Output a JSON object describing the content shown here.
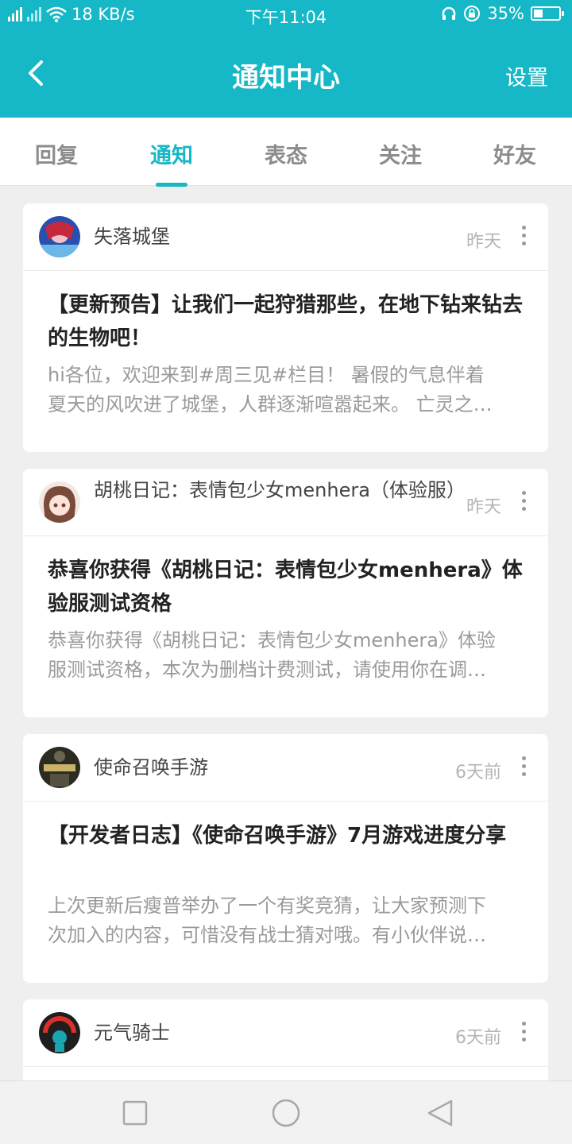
{
  "status_bar": {
    "network": "2G",
    "speed": "18 KB/s",
    "time": "下午11:04",
    "battery": "35%",
    "battery_level": 0.35
  },
  "header": {
    "title": "通知中心",
    "settings_label": "设置"
  },
  "tabs": [
    {
      "label": "回复",
      "active": false
    },
    {
      "label": "通知",
      "active": true
    },
    {
      "label": "表态",
      "active": false
    },
    {
      "label": "关注",
      "active": false
    },
    {
      "label": "好友",
      "active": false
    }
  ],
  "notifications": [
    {
      "author": "失落城堡",
      "time": "昨天",
      "title": "【更新预告】让我们一起狩猎那些，在地下钻来钻去的生物吧！",
      "body_lines": [
        "hi各位，欢迎来到#周三见#栏目！ 暑假的气息伴着",
        "夏天的风吹进了城堡，人群逐渐喧嚣起来。 亡灵之…"
      ]
    },
    {
      "author": "胡桃日记：表情包少女menhera（体验服）",
      "time": "昨天",
      "title": "恭喜你获得《胡桃日记：表情包少女menhera》体验服测试资格",
      "body_lines": [
        "恭喜你获得《胡桃日记：表情包少女menhera》体验",
        "服测试资格，本次为删档计费测试，请使用你在调…"
      ]
    },
    {
      "author": "使命召唤手游",
      "time": "6天前",
      "title": "【开发者日志】《使命召唤手游》7月游戏进度分享",
      "body_lines": [
        "上次更新后瘦普举办了一个有奖竞猜，让大家预测下",
        "次加入的内容，可惜没有战士猜对哦。有小伙伴说…"
      ]
    },
    {
      "author": "元气骑士",
      "time": "6天前"
    }
  ]
}
